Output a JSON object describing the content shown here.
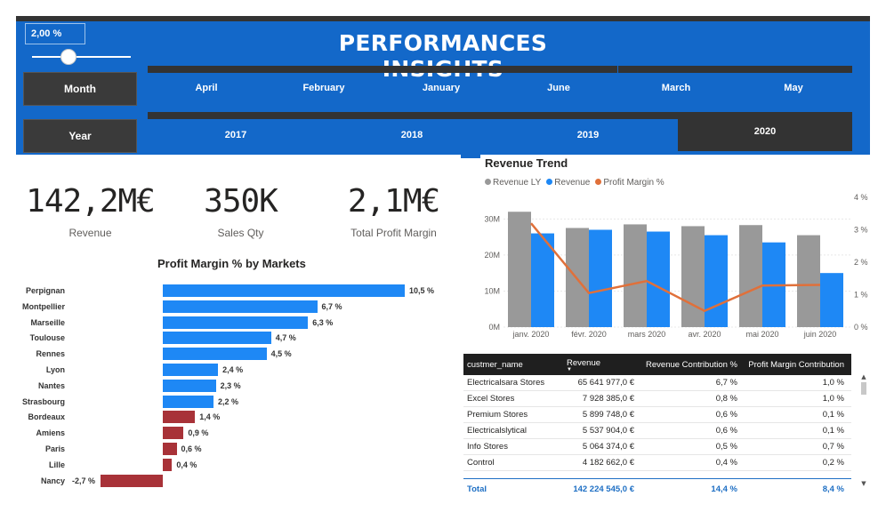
{
  "slicer": {
    "value": "2,00 %",
    "level_pct": 30
  },
  "header": {
    "title": "PERFORMANCES INSIGHTS",
    "month_button": "Month",
    "year_button": "Year",
    "months": [
      "April",
      "February",
      "January",
      "June",
      "March",
      "May"
    ],
    "years": [
      "2017",
      "2018",
      "2019",
      "2020"
    ],
    "selected_year": "2020"
  },
  "kpis": [
    {
      "value": "142,2M€",
      "label": "Revenue"
    },
    {
      "value": "350K",
      "label": "Sales Qty"
    },
    {
      "value": "2,1M€",
      "label": "Total Profit Margin"
    }
  ],
  "colors": {
    "blue": "#1e88f5",
    "gray": "#999999",
    "orange": "#e0703a",
    "red": "#a83238",
    "header": "#1368c9"
  },
  "chart_data": [
    {
      "type": "bar",
      "title": "Profit Margin % by Markets",
      "categories": [
        "Perpignan",
        "Montpellier",
        "Marseille",
        "Toulouse",
        "Rennes",
        "Lyon",
        "Nantes",
        "Strasbourg",
        "Bordeaux",
        "Amiens",
        "Paris",
        "Lille",
        "Nancy"
      ],
      "values": [
        10.5,
        6.7,
        6.3,
        4.7,
        4.5,
        2.4,
        2.3,
        2.2,
        1.4,
        0.9,
        0.6,
        0.4,
        -2.7
      ],
      "labels": [
        "10,5 %",
        "6,7 %",
        "6,3 %",
        "4,7 %",
        "4,5 %",
        "2,4 %",
        "2,3 %",
        "2,2 %",
        "1,4 %",
        "0,9 %",
        "0,6 %",
        "0,4 %",
        "-2,7 %"
      ]
    },
    {
      "type": "bar",
      "title": "Revenue Trend",
      "categories": [
        "janv. 2020",
        "févr. 2020",
        "mars 2020",
        "avr. 2020",
        "mai 2020",
        "juin 2020"
      ],
      "series": [
        {
          "name": "Revenue LY",
          "values": [
            32,
            27.5,
            28.5,
            28,
            28.3,
            25.5
          ]
        },
        {
          "name": "Revenue",
          "values": [
            26,
            27,
            26.5,
            25.5,
            23.5,
            15
          ]
        },
        {
          "name": "Profit Margin %",
          "values": [
            3.2,
            1.05,
            1.42,
            0.5,
            1.28,
            1.3
          ]
        }
      ],
      "y_ticks": [
        "0M",
        "10M",
        "20M",
        "30M"
      ],
      "y2_ticks": [
        "0 %",
        "1 %",
        "2 %",
        "3 %",
        "4 %"
      ],
      "ylim": [
        0,
        36
      ],
      "y2lim": [
        0,
        4
      ]
    }
  ],
  "table": {
    "headers": [
      "custmer_name",
      "Revenue",
      "Revenue Contribution %",
      "Profit Margin Contribution"
    ],
    "rows": [
      [
        "Electricalsara Stores",
        "65 641 977,0 €",
        "6,7 %",
        "1,0 %"
      ],
      [
        "Excel Stores",
        "7 928 385,0 €",
        "0,8 %",
        "1,0 %"
      ],
      [
        "Premium Stores",
        "5 899 748,0 €",
        "0,6 %",
        "0,1 %"
      ],
      [
        "Electricalslytical",
        "5 537 904,0 €",
        "0,6 %",
        "0,1 %"
      ],
      [
        "Info Stores",
        "5 064 374,0 €",
        "0,5 %",
        "0,7 %"
      ],
      [
        "Control",
        "4 182 662,0 €",
        "0,4 %",
        "0,2 %"
      ]
    ],
    "total": [
      "Total",
      "142 224 545,0 €",
      "14,4 %",
      "8,4 %"
    ]
  }
}
